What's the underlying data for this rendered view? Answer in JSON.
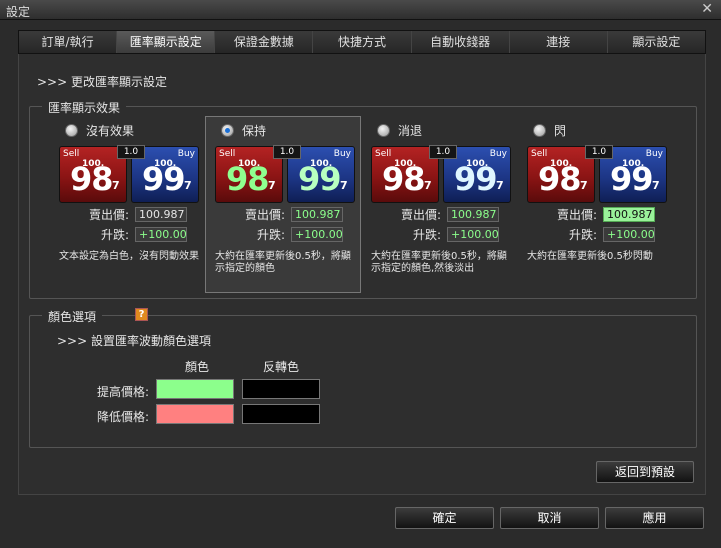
{
  "window": {
    "title": "設定",
    "close": "✕"
  },
  "tabs": [
    "訂單/執行",
    "匯率顯示設定",
    "保證金數據",
    "快捷方式",
    "自動收錢器",
    "連接",
    "顯示設定"
  ],
  "active_tab": 1,
  "section": {
    "heading": ">>> 更改匯率顯示設定",
    "group_label": "匯率顯示效果"
  },
  "effects": [
    {
      "label": "沒有效果",
      "checked": false,
      "card": {
        "sell_tag": "Sell",
        "buy_tag": "Buy",
        "spread": "1.0",
        "sell_small": "100.",
        "sell_big": "98",
        "sell_sub": "7",
        "buy_small": "100.",
        "buy_big": "99",
        "buy_sub": "7"
      },
      "sell_label": "賣出價:",
      "sell_value": "100.987",
      "change_label": "升跌:",
      "change_value": "+100.00",
      "desc": "文本設定為白色，沒有閃動效果"
    },
    {
      "label": "保持",
      "checked": true,
      "card": {
        "sell_tag": "Sell",
        "buy_tag": "Buy",
        "spread": "1.0",
        "sell_small": "100.",
        "sell_big": "98",
        "sell_sub": "7",
        "buy_small": "100.",
        "buy_big": "99",
        "buy_sub": "7"
      },
      "sell_label": "賣出價:",
      "sell_value": "100.987",
      "change_label": "升跌:",
      "change_value": "+100.00",
      "desc": "大約在匯率更新後0.5秒，將顯示指定的顏色"
    },
    {
      "label": "消退",
      "checked": false,
      "card": {
        "sell_tag": "Sell",
        "buy_tag": "Buy",
        "spread": "1.0",
        "sell_small": "100.",
        "sell_big": "98",
        "sell_sub": "7",
        "buy_small": "100.",
        "buy_big": "99",
        "buy_sub": "7"
      },
      "sell_label": "賣出價:",
      "sell_value": "100.987",
      "change_label": "升跌:",
      "change_value": "+100.00",
      "desc": "大約在匯率更新後0.5秒，將顯示指定的顏色,然後淡出"
    },
    {
      "label": "閃",
      "checked": false,
      "card": {
        "sell_tag": "Sell",
        "buy_tag": "Buy",
        "spread": "1.0",
        "sell_small": "100.",
        "sell_big": "98",
        "sell_sub": "7",
        "buy_small": "100.",
        "buy_big": "99",
        "buy_sub": "7"
      },
      "sell_label": "賣出價:",
      "sell_value": "100.987",
      "change_label": "升跌:",
      "change_value": "+100.00",
      "desc": "大約在匯率更新後0.5秒閃動"
    }
  ],
  "color_options": {
    "group_label": "顏色選項",
    "help": "?",
    "heading": ">>> 設置匯率波動顏色選項",
    "col_color": "顏色",
    "col_reverse": "反轉色",
    "rise_label": "提高價格:",
    "fall_label": "降低價格:",
    "rise_color": "#8cff8c",
    "rise_reverse": "#000000",
    "fall_color": "#ff8080",
    "fall_reverse": "#000000"
  },
  "buttons": {
    "reset": "返回到預設",
    "ok": "確定",
    "cancel": "取消",
    "apply": "應用"
  }
}
